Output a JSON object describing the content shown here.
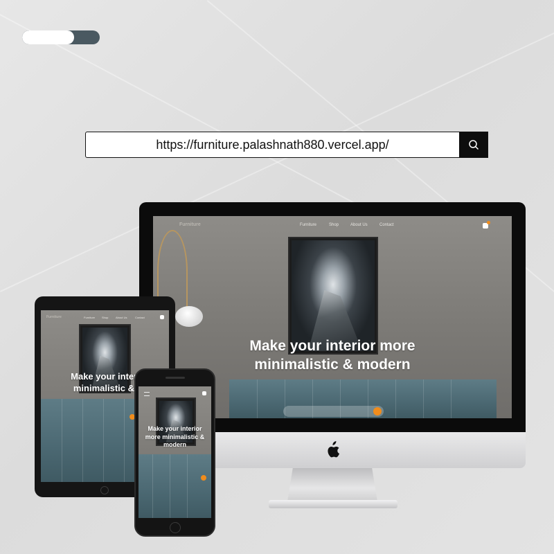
{
  "progress": {
    "fraction": 0.67
  },
  "urlbar": {
    "url": "https://furniture.palashnath880.vercel.app/",
    "button_icon": "search-icon"
  },
  "site": {
    "logo": "Furniture",
    "nav": [
      "Furniture",
      "Shop",
      "About Us",
      "Contact"
    ],
    "hero_line1": "Make your interior more",
    "hero_line2": "minimalistic & modern",
    "tablet_hero_line1": "Make your interior",
    "tablet_hero_line2": "minimalistic & mo",
    "phone_hero_line1": "Make your interior",
    "phone_hero_line2": "more minimalistic &",
    "phone_hero_line3": "modern",
    "accent": "#f08c1c"
  },
  "devices": {
    "desktop_brand_icon": "apple-logo-icon"
  }
}
